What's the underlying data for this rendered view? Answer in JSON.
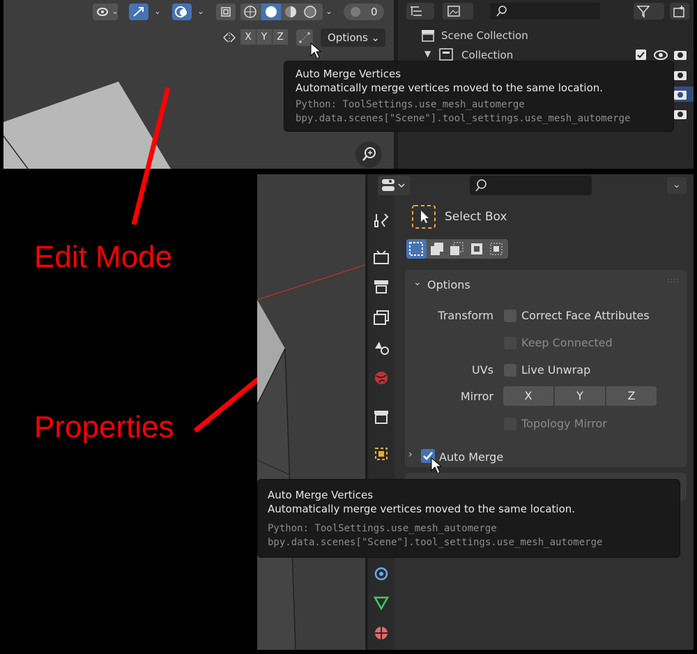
{
  "top": {
    "overlay_count": "0",
    "axis_buttons": [
      "X",
      "Y",
      "Z"
    ],
    "options_dropdown": "Options",
    "outliner": {
      "scene_collection": "Scene Collection",
      "collection": "Collection"
    },
    "tooltip": {
      "title": "Auto Merge Vertices",
      "description": "Automatically merge vertices moved to the same location.",
      "python_line1": "Python: ToolSettings.use_mesh_automerge",
      "python_line2": "bpy.data.scenes[\"Scene\"].tool_settings.use_mesh_automerge"
    }
  },
  "annotations": {
    "edit_mode": "Edit Mode",
    "properties": "Properties"
  },
  "properties": {
    "tool_name": "Select Box",
    "options_header": "Options",
    "transform_label": "Transform",
    "correct_face_attributes": "Correct Face Attributes",
    "keep_connected": "Keep Connected",
    "uvs_label": "UVs",
    "live_unwrap": "Live Unwrap",
    "mirror_label": "Mirror",
    "mirror_axes": [
      "X",
      "Y",
      "Z"
    ],
    "topology_mirror": "Topology Mirror",
    "auto_merge": "Auto Merge",
    "auto_merge_checked": true,
    "tooltip": {
      "title": "Auto Merge Vertices",
      "description": "Automatically merge vertices moved to the same location.",
      "python_line1": "Python: ToolSettings.use_mesh_automerge",
      "python_line2": "bpy.data.scenes[\"Scene\"].tool_settings.use_mesh_automerge"
    }
  },
  "colors": {
    "accent_blue": "#4772b3",
    "annotation_red": "#ff0000",
    "selection_orange": "#e8a93a"
  }
}
